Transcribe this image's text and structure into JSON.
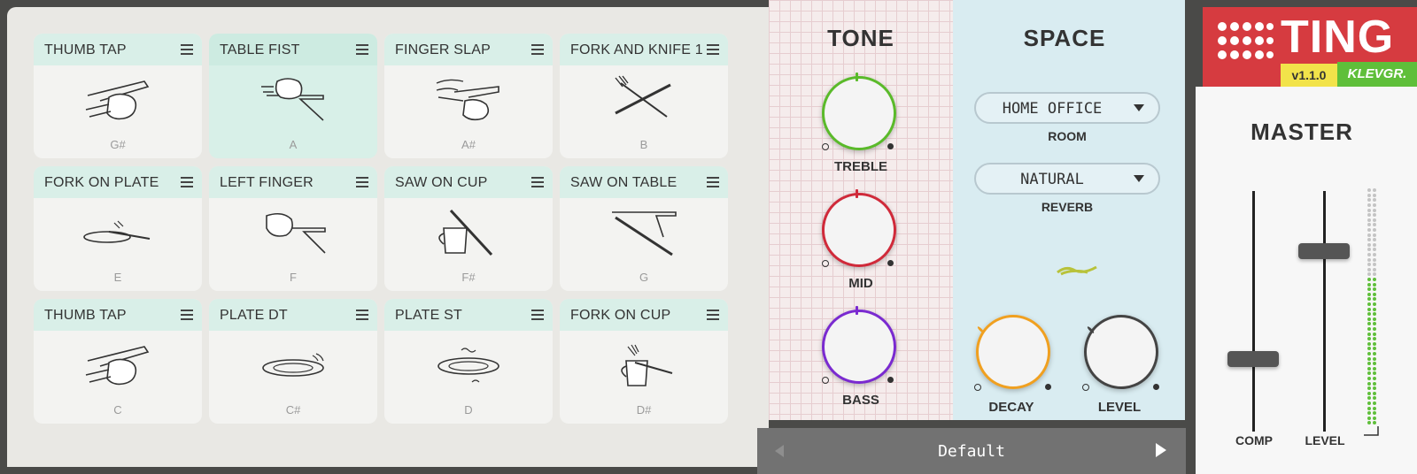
{
  "pads": [
    {
      "name": "THUMB TAP",
      "note": "G#",
      "illustration": "thumb-tap-icon",
      "active": false
    },
    {
      "name": "TABLE FIST",
      "note": "A",
      "illustration": "table-fist-icon",
      "active": true
    },
    {
      "name": "FINGER SLAP",
      "note": "A#",
      "illustration": "finger-slap-icon",
      "active": false
    },
    {
      "name": "FORK AND KNIFE 1",
      "note": "B",
      "illustration": "fork-and-knife-icon",
      "active": false
    },
    {
      "name": "FORK ON PLATE",
      "note": "E",
      "illustration": "fork-on-plate-icon",
      "active": false
    },
    {
      "name": "LEFT FINGER",
      "note": "F",
      "illustration": "left-finger-icon",
      "active": false
    },
    {
      "name": "SAW ON CUP",
      "note": "F#",
      "illustration": "saw-on-cup-icon",
      "active": false
    },
    {
      "name": "SAW ON TABLE",
      "note": "G",
      "illustration": "saw-on-table-icon",
      "active": false
    },
    {
      "name": "THUMB TAP",
      "note": "C",
      "illustration": "thumb-tap-icon",
      "active": false
    },
    {
      "name": "PLATE DT",
      "note": "C#",
      "illustration": "plate-icon",
      "active": false
    },
    {
      "name": "PLATE ST",
      "note": "D",
      "illustration": "plate-icon",
      "active": false
    },
    {
      "name": "FORK ON CUP",
      "note": "D#",
      "illustration": "fork-on-cup-icon",
      "active": false
    }
  ],
  "tone": {
    "title": "TONE",
    "knobs": [
      {
        "label": "TREBLE",
        "color": "#5aba2a"
      },
      {
        "label": "MID",
        "color": "#d02a3a"
      },
      {
        "label": "BASS",
        "color": "#7a2ad0"
      }
    ]
  },
  "space": {
    "title": "SPACE",
    "room": {
      "value": "HOME OFFICE",
      "label": "ROOM"
    },
    "reverb": {
      "value": "NATURAL",
      "label": "REVERB"
    },
    "knobs": [
      {
        "label": "DECAY",
        "color": "#f0a020"
      },
      {
        "label": "LEVEL",
        "color": "#444444"
      }
    ]
  },
  "preset": {
    "name": "Default"
  },
  "logo": {
    "title": "TING",
    "version": "v1.1.0",
    "brand": "KLEVGR."
  },
  "master": {
    "title": "MASTER",
    "comp_label": "COMP",
    "level_label": "LEVEL",
    "comp_value": 0.3,
    "level_value": 0.75,
    "meter_value": 0.62
  },
  "colors": {
    "pad_header": "#d9efe8",
    "accent_green": "#5fbf3a",
    "logo_red": "#d63b40"
  }
}
